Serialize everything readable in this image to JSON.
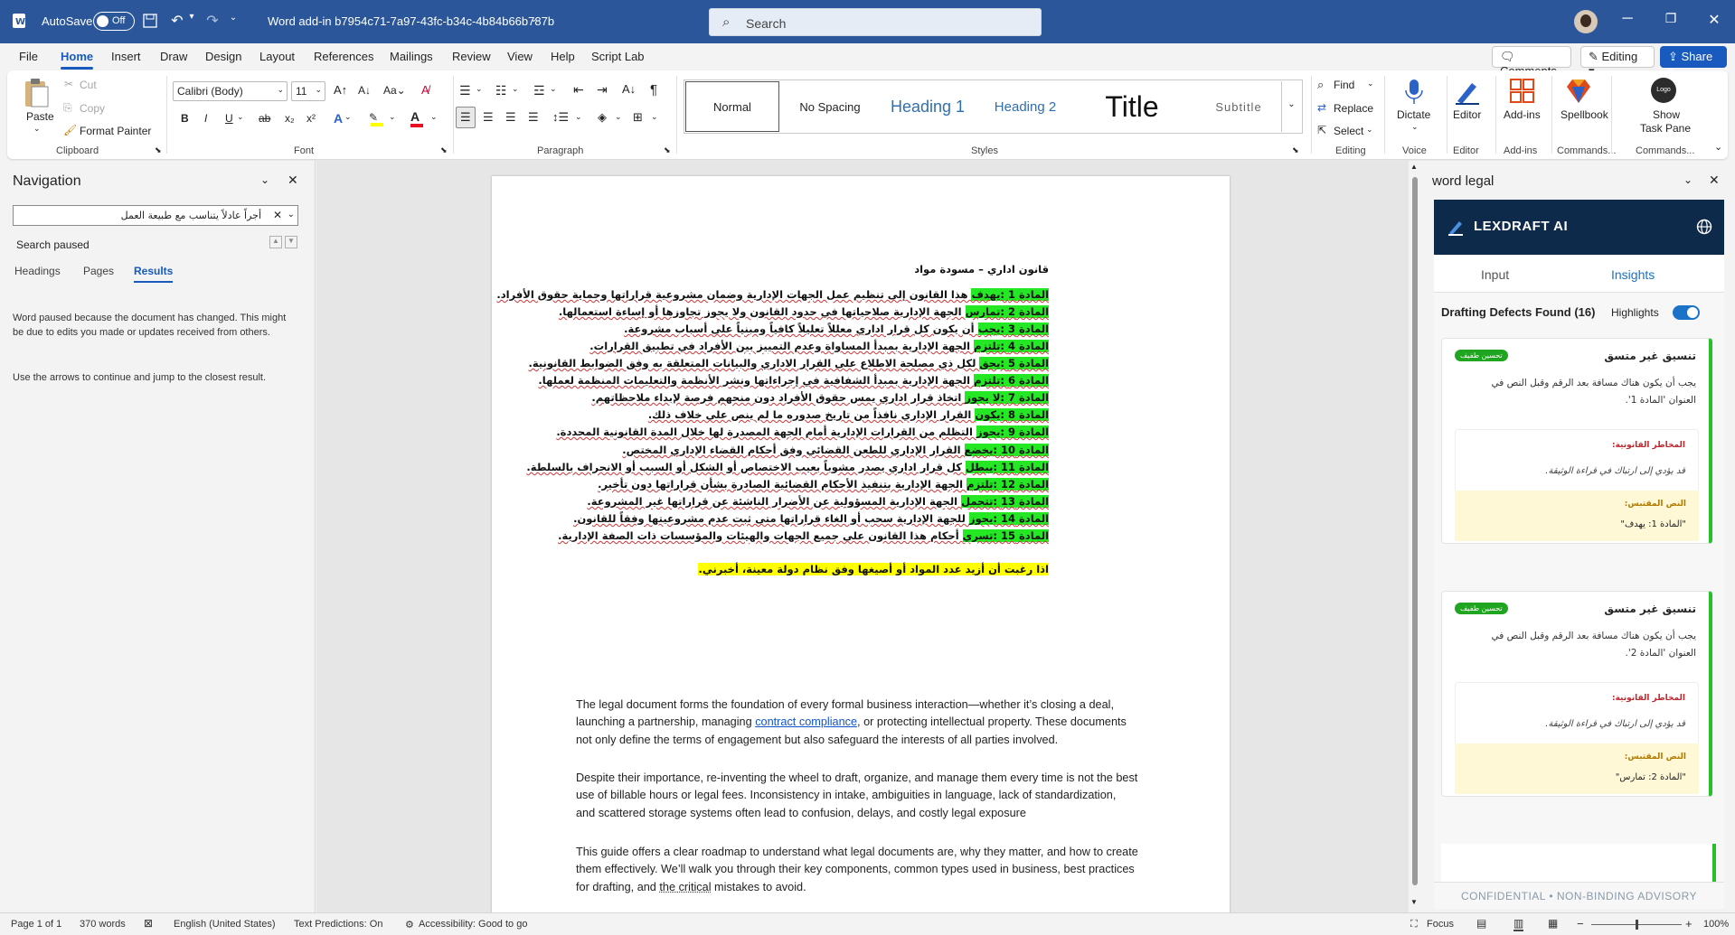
{
  "titlebar": {
    "autosave_label": "AutoSave",
    "autosave_state": "Off",
    "doc_title": "Word add-in b7954c71-7a97-43fc-b34c-4b84b66b787b",
    "search_placeholder": "Search"
  },
  "menu": [
    "File",
    "Home",
    "Insert",
    "Draw",
    "Design",
    "Layout",
    "References",
    "Mailings",
    "Review",
    "View",
    "Help",
    "Script Lab"
  ],
  "topright": {
    "comments": "Comments",
    "editing": "Editing",
    "share": "Share"
  },
  "ribbon": {
    "clipboard": {
      "paste": "Paste",
      "cut": "Cut",
      "copy": "Copy",
      "format_painter": "Format Painter",
      "label": "Clipboard"
    },
    "font": {
      "family": "Calibri (Body)",
      "size": "11",
      "label": "Font"
    },
    "paragraph": {
      "label": "Paragraph"
    },
    "styles": {
      "items": [
        "Normal",
        "No Spacing",
        "Heading 1",
        "Heading 2",
        "Title",
        "Subtitle"
      ],
      "label": "Styles"
    },
    "editing": {
      "find": "Find",
      "replace": "Replace",
      "select": "Select",
      "label": "Editing"
    },
    "voice": {
      "dictate": "Dictate",
      "label": "Voice"
    },
    "editor": {
      "name": "Editor",
      "label": "Editor"
    },
    "addins": {
      "name": "Add-ins",
      "label": "Add-ins"
    },
    "spellbook": {
      "name": "Spellbook",
      "label": "Commands..."
    },
    "taskpane": {
      "name1": "Show",
      "name2": "Task Pane",
      "logo": "Logo",
      "label": "Commands..."
    }
  },
  "nav": {
    "title": "Navigation",
    "search_value": "أجراً عادلاً يتناسب مع طبيعة العمل",
    "search_status": "Search paused",
    "tabs": [
      "Headings",
      "Pages",
      "Results"
    ],
    "message1": "Word paused because the document has changed. This might be due to edits you made or updates received from others.",
    "message2": "Use the arrows to continue and jump to the closest result."
  },
  "doc": {
    "heading": "قانون اداري – مسودة مواد",
    "articles": [
      {
        "label": "المادة 1 :يهدف",
        "text": " هذا القانون إلى تنظيم عمل الجهات الإدارية وضمان مشروعية قراراتها وحماية حقوق الأفراد."
      },
      {
        "label": "المادة 2 :تمارس",
        "text": " الجهة الإدارية صلاحياتها في حدود القانون ولا يجوز تجاوزها أو إساءة استعمالها."
      },
      {
        "label": "المادة 3 :يجب",
        "text": " أن يكون كل قرار اداري معللاً تعليلاً كافياً ومبنياً على أسباب مشروعة."
      },
      {
        "label": "المادة 4 :تلتزم",
        "text": " الجهة الإدارية بمبدأ المساواة وعدم التمييز بين الأفراد في تطبيق القرارات."
      },
      {
        "label": "المادة 5 :يحق",
        "text": " لكل ذي مصلحة الاطلاع على القرار الاداري والبيانات المتعلقة به وفق الضوابط القانونية."
      },
      {
        "label": "المادة 6 :تلتزم",
        "text": " الجهة الإدارية بمبدأ الشفافية في إجراءاتها ونشر الأنظمة والتعليمات المنظمة لعملها."
      },
      {
        "label": "المادة 7 :لا يجوز",
        "text": " اتخاذ قرار اداري يمس حقوق الأفراد دون منحهم فرصة لإبداء ملاحظاتهم."
      },
      {
        "label": "المادة 8 :يكون",
        "text": " القرار الإداري نافذاً من تاريخ صدوره ما لم ينص على خلاف ذلك."
      },
      {
        "label": "المادة 9 :يجوز",
        "text": " التظلم من القرارات الإدارية أمام الجهة المصدرة لها خلال المدة القانونية المحددة."
      },
      {
        "label": "المادة 10 :يخضع",
        "text": " القرار الإداري للطعن القضائي وفق أحكام القضاء الإداري المختص."
      },
      {
        "label": "المادة 11 :يبطل",
        "text": " كل قرار اداري يصدر مشوباً بعيب الاختصاص أو الشكل أو السبب أو الانحراف بالسلطة."
      },
      {
        "label": "المادة 12 :تلتزم",
        "text": " الجهة الإدارية بتنفيذ الأحكام القضائية الصادرة بشأن قراراتها دون تأخير."
      },
      {
        "label": "المادة 13 :تتحمل",
        "text": " الجهة الإدارية المسؤولية عن الأضرار الناشئة عن قراراتها غير المشروعة."
      },
      {
        "label": "المادة 14 :يجوز",
        "text": " للجهة الإدارية سحب أو الغاء قراراتها متى ثبت عدم مشروعيتها وفقاً للقانون."
      },
      {
        "label": "المادة 15 :تسري",
        "text": " أحكام هذا القانون على جميع الجهات والهيئات والمؤسسات ذات الصفة الإدارية."
      }
    ],
    "closing": "اذا رغبت أن أزيد عدد المواد أو أصيغها وفق نظام دولة معينة، أخبرني.",
    "p1_a": "The legal document forms the foundation of every formal business interaction—whether it’s closing a deal, launching a partnership, managing ",
    "p1_link": "contract compliance",
    "p1_b": ", or protecting intellectual property. These documents not only define the terms of engagement but also safeguard the interests of all parties involved.",
    "p2": "Despite their importance, re-inventing the wheel to draft, organize, and manage them every time is not the best use of billable hours or legal fees. Inconsistency in intake, ambiguities in language, lack of standardization, and scattered storage systems often lead to confusion, delays, and costly legal exposure",
    "p3_a": "This guide offers a clear roadmap to understand what legal documents are, why they matter, and how to create them effectively. We’ll walk you through their key components, common types used in business, best practices for drafting, and ",
    "p3_link": "the critical",
    "p3_b": " mistakes to avoid."
  },
  "taskpane": {
    "title": "word legal",
    "brand": "LEXDRAFT AI",
    "tabs": [
      "Input",
      "Insights"
    ],
    "defects_title": "Drafting Defects Found (16)",
    "highlights_label": "Highlights",
    "highlights_on": true,
    "cards": [
      {
        "badge": "تحسين طفيف",
        "title": "تنسيق غير متسق",
        "desc": "يجب أن يكون هناك مسافة بعد الرقم وقبل النص في العنوان 'المادة 1'.",
        "risk_label": "المخاطر القانونية:",
        "risk": "قد يؤدي إلى ارتباك في قراءة الوثيقة.",
        "quote_label": "النص المقتبس:",
        "quote": "\"المادة 1: يهدف\""
      },
      {
        "badge": "تحسين طفيف",
        "title": "تنسيق غير متسق",
        "desc": "يجب أن يكون هناك مسافة بعد الرقم وقبل النص في العنوان 'المادة 2'.",
        "risk_label": "المخاطر القانونية:",
        "risk": "قد يؤدي إلى ارتباك في قراءة الوثيقة.",
        "quote_label": "النص المقتبس:",
        "quote": "\"المادة 2: تمارس\""
      }
    ],
    "footer": "CONFIDENTIAL • NON-BINDING ADVISORY"
  },
  "status": {
    "page": "Page 1 of 1",
    "words": "370 words",
    "language": "English (United States)",
    "predictions": "Text Predictions: On",
    "accessibility": "Accessibility: Good to go",
    "focus": "Focus",
    "zoom": "100%",
    "zoom_level": 1.0
  },
  "colors": {
    "titlebar": "#2b579a",
    "accent": "#185abd",
    "highlight_green": "#23e823",
    "highlight_yellow": "#ffff00",
    "lex_navy": "#0e2a4a"
  }
}
